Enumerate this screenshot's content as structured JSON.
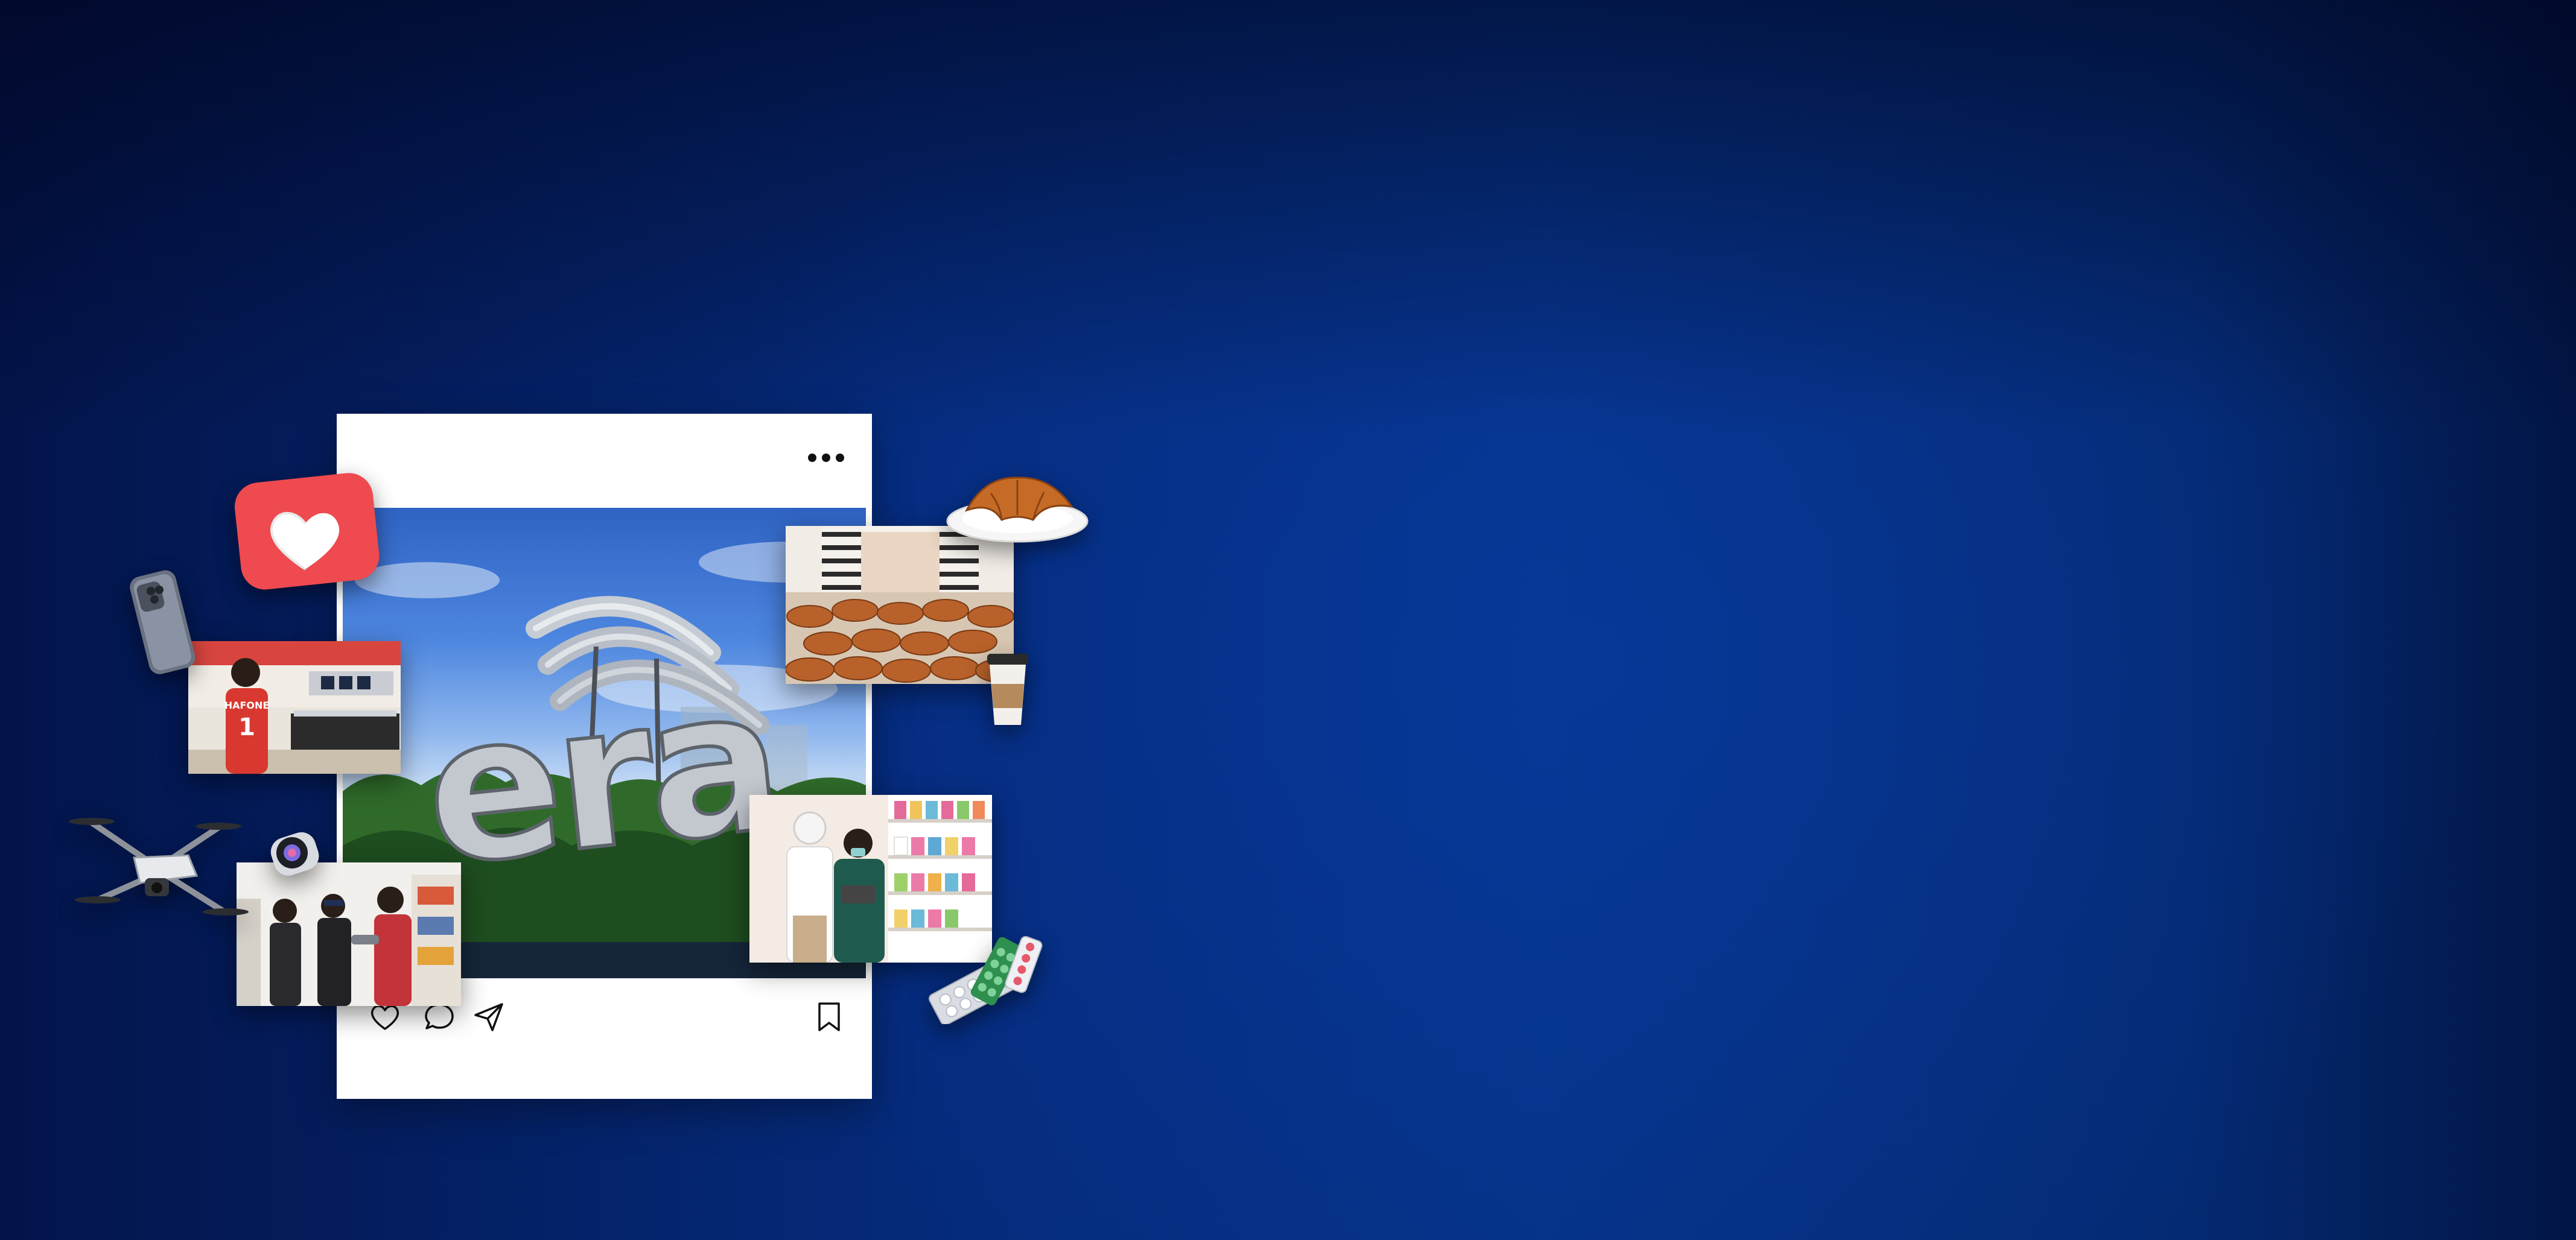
{
  "post": {
    "menu_icon": "more-dots-icon",
    "sign_text": "era",
    "actions": {
      "like_icon": "heart-outline-icon",
      "comment_icon": "comment-bubble-icon",
      "share_icon": "send-arrow-icon",
      "save_icon": "bookmark-icon"
    }
  },
  "photos": {
    "phone_store": {
      "jersey_text": "HAFONE",
      "jersey_number": "1"
    }
  },
  "stickers": {
    "like": "heart-like-icon",
    "phone": "smartphone-icon",
    "drone": "drone-icon",
    "watch": "smartwatch-icon",
    "croissant": "croissant-plate-icon",
    "coffee": "coffee-cup-icon",
    "pills": "pill-blister-icon"
  },
  "colors": {
    "background_dark": "#03144a",
    "background_mid": "#053285",
    "card": "#ffffff",
    "like_red": "#ee4a4f"
  }
}
